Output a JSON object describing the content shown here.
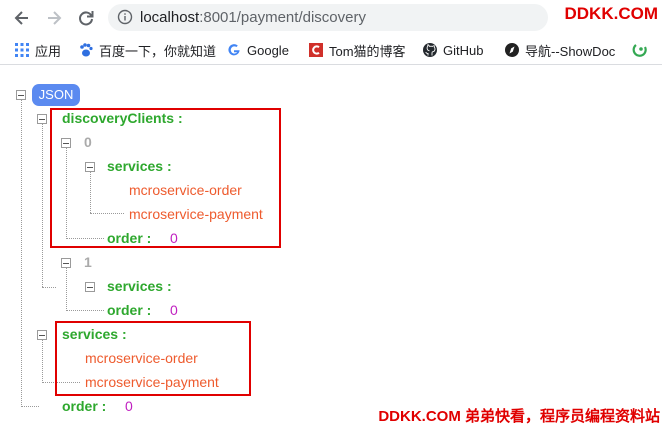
{
  "browser": {
    "url_host": "localhost",
    "url_rest": ":8001/payment/discovery",
    "brand": "DDKK.COM"
  },
  "bookmarks": [
    {
      "label": "应用",
      "icon": "apps-grid-icon"
    },
    {
      "label": "百度一下，你就知道",
      "icon": "baidu-paw-icon"
    },
    {
      "label": "Google",
      "icon": "google-g-icon"
    },
    {
      "label": "Tom猫的博客",
      "icon": "tom-blog-icon"
    },
    {
      "label": "GitHub",
      "icon": "github-icon"
    },
    {
      "label": "导航--ShowDoc",
      "icon": "showdoc-icon"
    }
  ],
  "json": {
    "badge": "JSON",
    "discovery_key": "discoveryClients :",
    "index_0": "0",
    "index_1": "1",
    "services_key": "services :",
    "order_key": "order :",
    "order_value": "0",
    "service_order": "mcroservice-order",
    "service_payment": "mcroservice-payment"
  },
  "footer": "DDKK.COM 弟弟快看，程序员编程资料站",
  "colors": {
    "key": "#2ea82e",
    "string": "#ee5b2e",
    "number": "#c020c0",
    "badge": "#5b8af0",
    "highlight": "#e00000"
  }
}
